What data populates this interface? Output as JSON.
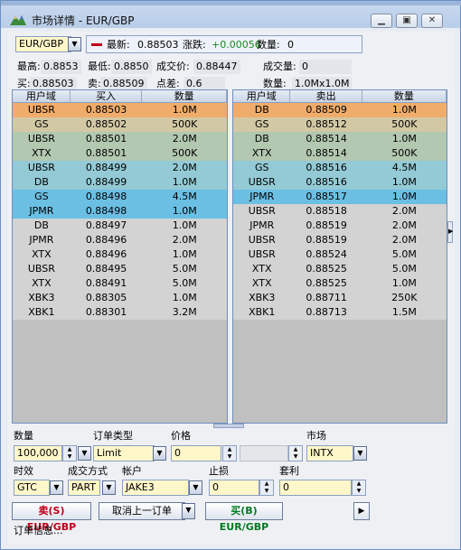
{
  "window": {
    "title": "市场详情 - EUR/GBP",
    "min": "▁",
    "max": "▣",
    "close": "✕"
  },
  "symbol": {
    "value": "EUR/GBP"
  },
  "quote": {
    "last_label": "最新:",
    "last_value": "0.88503",
    "change_label": "涨跌:",
    "change_value": "+0.00056",
    "qty_label": "数量:",
    "qty_value": "0"
  },
  "stats": {
    "high_label": "最高:",
    "high": "0.8853",
    "low_label": "最低:",
    "low": "0.8850",
    "trade_label": "成交价:",
    "trade": "0.88447",
    "vol_label": "成交量:",
    "vol": "0",
    "buy_label": "买:",
    "buy": "0.88503",
    "sell_label": "卖:",
    "sell": "0.88509",
    "spread_label": "点差:",
    "spread": "0.6",
    "depth_label": "数量:",
    "depth": "1.0Mx1.0M"
  },
  "bid_table": {
    "headers": [
      "用户域",
      "买入",
      "数量"
    ],
    "rows": [
      {
        "c": "UBSR",
        "p": "0.88503",
        "q": "1.0M",
        "bg": "#f0ac6a"
      },
      {
        "c": "GS",
        "p": "0.88502",
        "q": "500K",
        "bg": "#d3c8a4"
      },
      {
        "c": "UBSR",
        "p": "0.88501",
        "q": "2.0M",
        "bg": "#b2c8b0"
      },
      {
        "c": "XTX",
        "p": "0.88501",
        "q": "500K",
        "bg": "#b2c8b0"
      },
      {
        "c": "UBSR",
        "p": "0.88499",
        "q": "2.0M",
        "bg": "#93cad6"
      },
      {
        "c": "DB",
        "p": "0.88499",
        "q": "1.0M",
        "bg": "#93cad6"
      },
      {
        "c": "GS",
        "p": "0.88498",
        "q": "4.5M",
        "bg": "#6bbfe3"
      },
      {
        "c": "JPMR",
        "p": "0.88498",
        "q": "1.0M",
        "bg": "#6bbfe3"
      },
      {
        "c": "DB",
        "p": "0.88497",
        "q": "1.0M",
        "bg": "#d3d3d3"
      },
      {
        "c": "JPMR",
        "p": "0.88496",
        "q": "2.0M",
        "bg": "#d3d3d3"
      },
      {
        "c": "XTX",
        "p": "0.88496",
        "q": "1.0M",
        "bg": "#d3d3d3"
      },
      {
        "c": "UBSR",
        "p": "0.88495",
        "q": "5.0M",
        "bg": "#d3d3d3"
      },
      {
        "c": "XTX",
        "p": "0.88491",
        "q": "5.0M",
        "bg": "#d3d3d3"
      },
      {
        "c": "XBK3",
        "p": "0.88305",
        "q": "1.0M",
        "bg": "#d3d3d3"
      },
      {
        "c": "XBK1",
        "p": "0.88301",
        "q": "3.2M",
        "bg": "#d3d3d3"
      }
    ]
  },
  "ask_table": {
    "headers": [
      "用户域",
      "卖出",
      "数量"
    ],
    "rows": [
      {
        "c": "DB",
        "p": "0.88509",
        "q": "1.0M",
        "bg": "#f0ac6a"
      },
      {
        "c": "GS",
        "p": "0.88512",
        "q": "500K",
        "bg": "#d3c8a4"
      },
      {
        "c": "DB",
        "p": "0.88514",
        "q": "1.0M",
        "bg": "#b2c8b0"
      },
      {
        "c": "XTX",
        "p": "0.88514",
        "q": "500K",
        "bg": "#b2c8b0"
      },
      {
        "c": "GS",
        "p": "0.88516",
        "q": "4.5M",
        "bg": "#93cad6"
      },
      {
        "c": "UBSR",
        "p": "0.88516",
        "q": "1.0M",
        "bg": "#93cad6"
      },
      {
        "c": "JPMR",
        "p": "0.88517",
        "q": "1.0M",
        "bg": "#6bbfe3"
      },
      {
        "c": "UBSR",
        "p": "0.88518",
        "q": "2.0M",
        "bg": "#d3d3d3"
      },
      {
        "c": "JPMR",
        "p": "0.88519",
        "q": "2.0M",
        "bg": "#d3d3d3"
      },
      {
        "c": "UBSR",
        "p": "0.88519",
        "q": "2.0M",
        "bg": "#d3d3d3"
      },
      {
        "c": "UBSR",
        "p": "0.88524",
        "q": "5.0M",
        "bg": "#d3d3d3"
      },
      {
        "c": "XTX",
        "p": "0.88525",
        "q": "5.0M",
        "bg": "#d3d3d3"
      },
      {
        "c": "XTX",
        "p": "0.88525",
        "q": "1.0M",
        "bg": "#d3d3d3"
      },
      {
        "c": "XBK3",
        "p": "0.88711",
        "q": "250K",
        "bg": "#d3d3d3"
      },
      {
        "c": "XBK1",
        "p": "0.88713",
        "q": "1.5M",
        "bg": "#d3d3d3"
      }
    ]
  },
  "order": {
    "qty_label": "数量",
    "qty_value": "100,000",
    "type_label": "订单类型",
    "type_value": "Limit",
    "price_label": "价格",
    "price_value": "0",
    "market_label": "市场",
    "market_value": "INTX",
    "tif_label": "时效",
    "tif_value": "GTC",
    "exec_label": "成交方式",
    "exec_value": "PART",
    "account_label": "帐户",
    "account_value": "JAKE3",
    "stop_label": "止损",
    "stop_value": "0",
    "profit_label": "套利",
    "profit_value": "0"
  },
  "actions": {
    "sell_label": "卖(S) EUR/GBP",
    "cancel_label": "取消上一订单",
    "buy_label": "买(B) EUR/GBP",
    "info_label": "订单信息..."
  },
  "colors": {
    "sell": "#c0001a",
    "buy": "#007a1f",
    "up": "#1a8a1a"
  }
}
